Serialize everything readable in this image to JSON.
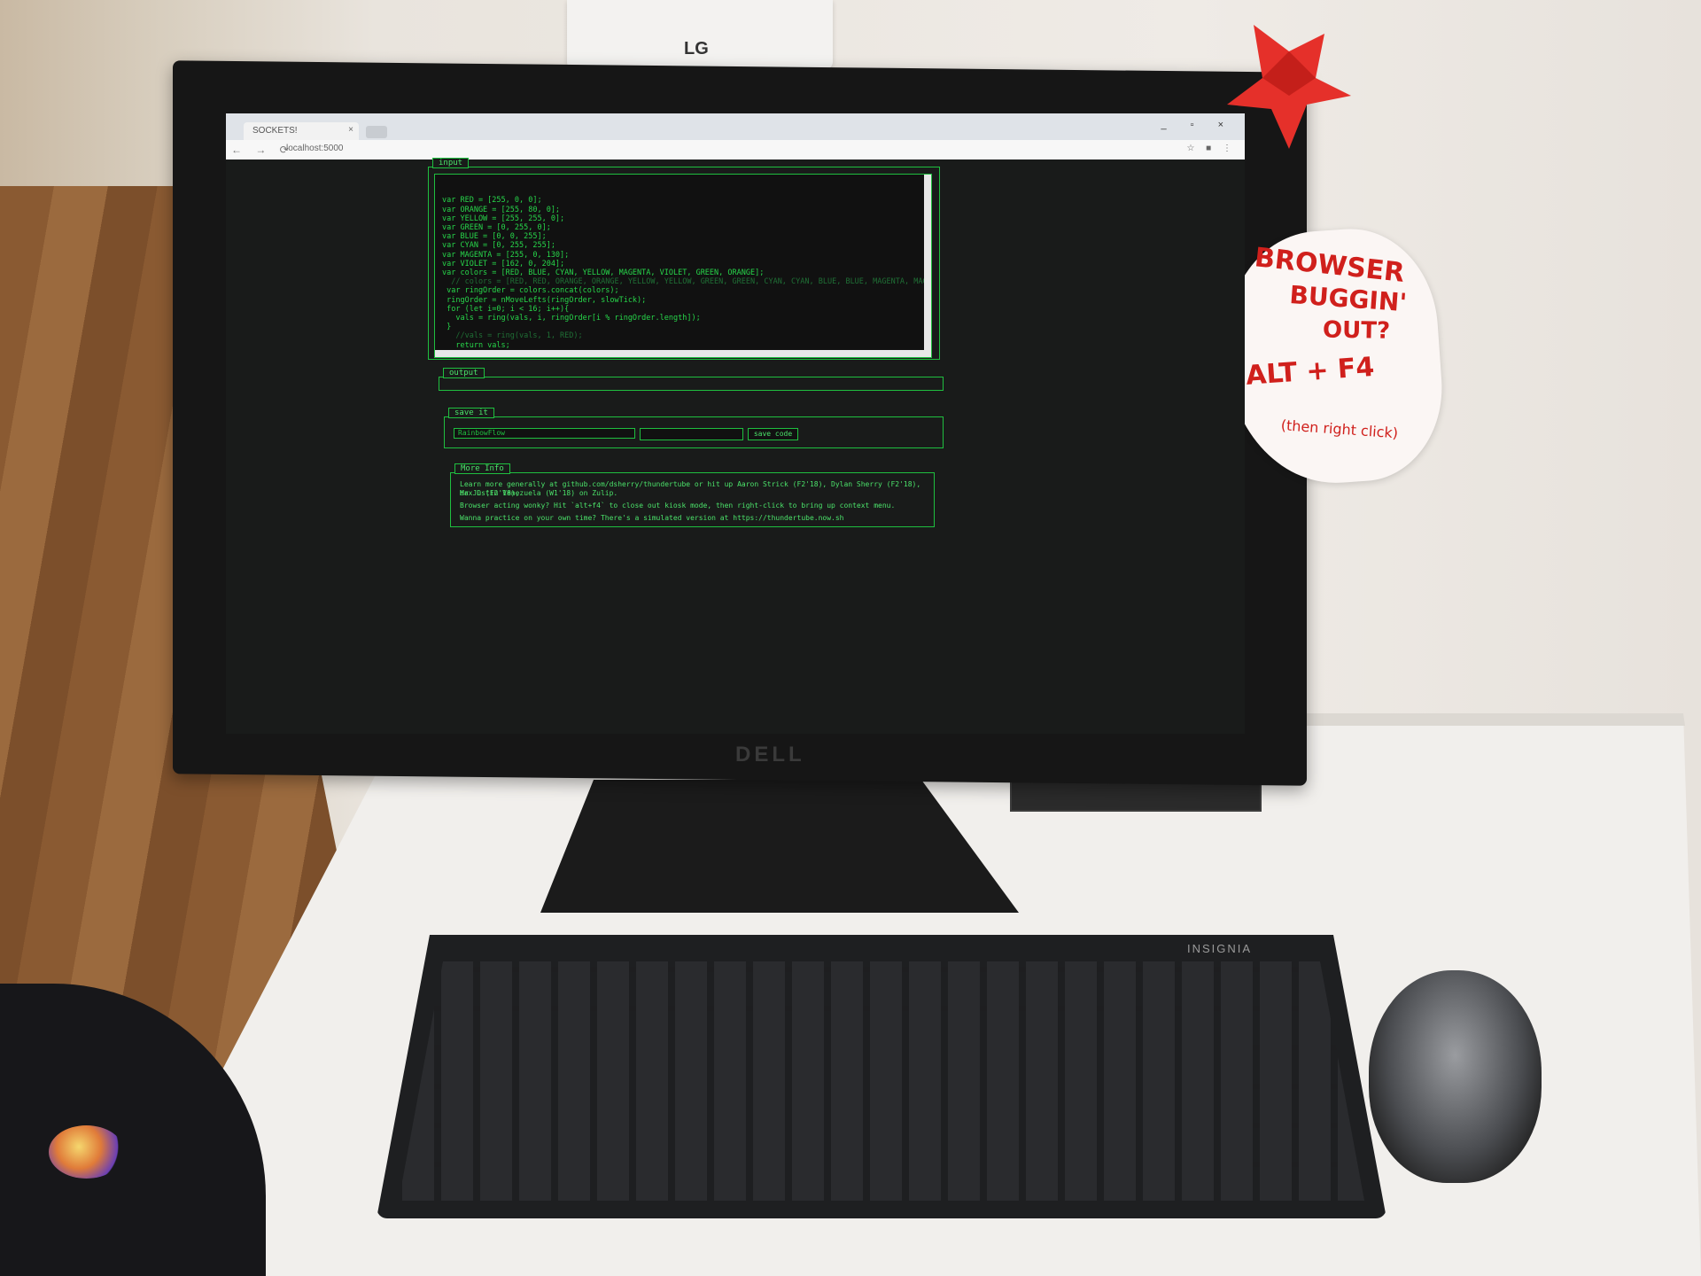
{
  "wall": {
    "brand": "LG"
  },
  "monitor": {
    "brand": "DELL"
  },
  "browser": {
    "tab_title": "SOCKETS!",
    "tab_close": "×",
    "window_buttons": "_ ▫ ×",
    "nav_icons": "← → ⟳",
    "url": "localhost:5000",
    "ext_icons": "☆ ■ ⋮"
  },
  "page": {
    "code_label": "input",
    "code_lines": [
      "var RED = [255, 0, 0];",
      "var ORANGE = [255, 80, 0];",
      "var YELLOW = [255, 255, 0];",
      "var GREEN = [0, 255, 0];",
      "var BLUE = [0, 0, 255];",
      "var CYAN = [0, 255, 255];",
      "var MAGENTA = [255, 0, 130];",
      "var VIOLET = [162, 0, 204];",
      "var colors = [RED, BLUE, CYAN, YELLOW, MAGENTA, VIOLET, GREEN, ORANGE];",
      "  // colors = [RED, RED, ORANGE, ORANGE, YELLOW, YELLOW, GREEN, GREEN, CYAN, CYAN, BLUE, BLUE, MAGENTA, MAGENTA, VIOL",
      " var ringOrder = colors.concat(colors);",
      " ringOrder = nMoveLefts(ringOrder, slowTick);",
      " for (let i=0; i < 16; i++){",
      "   vals = ring(vals, i, ringOrder[i % ringOrder.length]);",
      " }",
      "   //vals = ring(vals, 1, RED);",
      "   return vals;",
      "",
      "}"
    ],
    "output_label": "output",
    "save_label": "save it",
    "select_value": "RainbowFlow",
    "save_button": "save code",
    "info_label": "More Info",
    "info_lines": [
      "Learn more generally at github.com/dsherry/thundertube or hit up Aaron Strick (F2'18), Dylan Sherry (F2'18), Max D (F2'18),",
      "or Justin Venezuela (W1'18) on Zulip.",
      "Browser acting wonky? Hit `alt+f4` to close out kiosk mode, then right-click to bring up context menu.",
      "Wanna practice on your own time? There's a simulated version at https://thundertube.now.sh"
    ]
  },
  "note": {
    "line1": "BROWSER",
    "line2": "BUGGIN'",
    "line3": "OUT?",
    "line4": "ALT + F4",
    "line5": "(then right click)"
  },
  "keyboard": {
    "brand": "INSIGNIA"
  },
  "colors": {
    "terminal_green": "#27d64a",
    "note_red": "#d0201c",
    "screen_bg": "#191b1a"
  }
}
